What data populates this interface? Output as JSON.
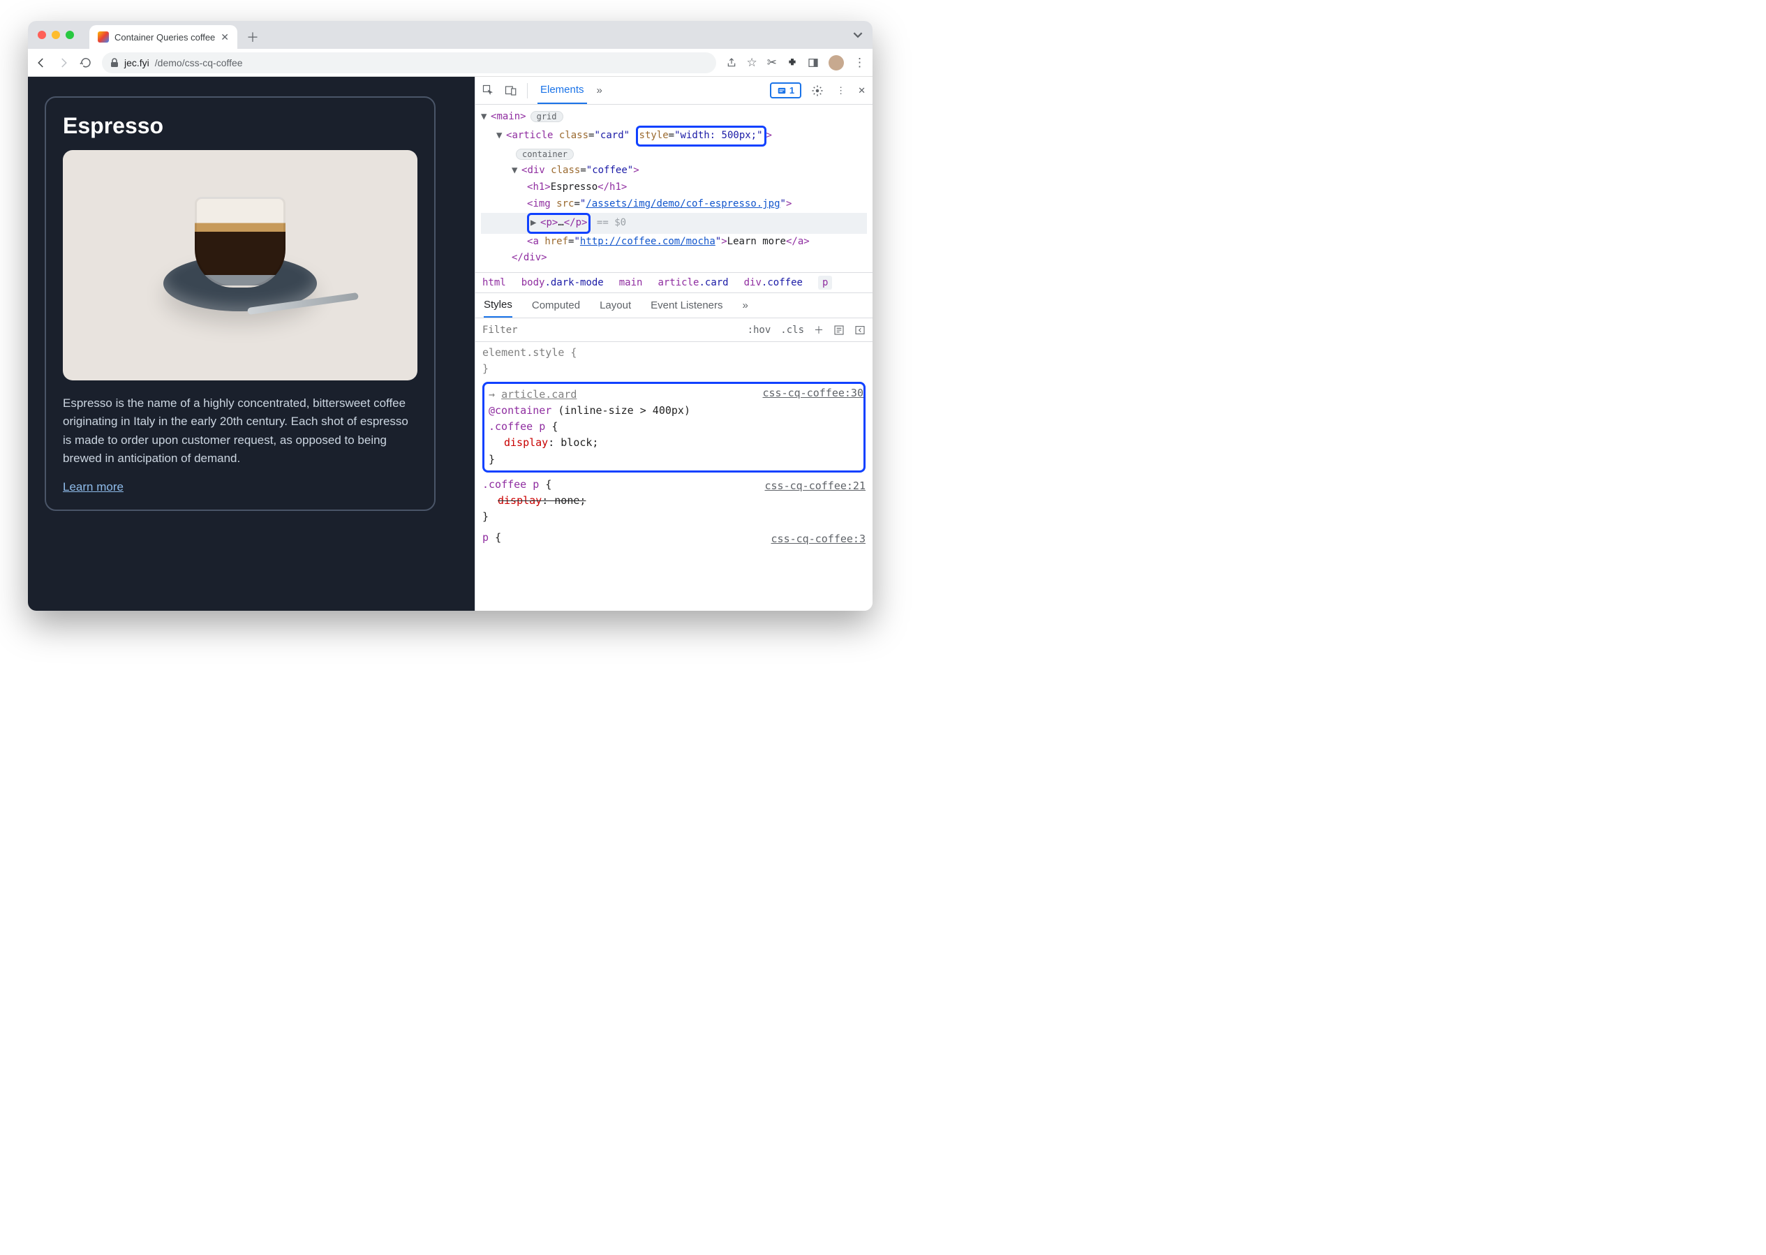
{
  "browser": {
    "tab_title": "Container Queries coffee",
    "url_host": "jec.fyi",
    "url_path": "/demo/css-cq-coffee"
  },
  "page": {
    "card_title": "Espresso",
    "card_desc": "Espresso is the name of a highly concentrated, bittersweet coffee originating in Italy in the early 20th century. Each shot of espresso is made to order upon customer request, as opposed to being brewed in anticipation of demand.",
    "card_link": "Learn more"
  },
  "devtools": {
    "tabs": {
      "elements": "Elements"
    },
    "issues_count": "1",
    "dom": {
      "main": "main",
      "grid": "grid",
      "article": "article",
      "class": "class",
      "card": "card",
      "style_attr": "style=\"width: 500px;\"",
      "container": "container",
      "div": "div",
      "coffee": "coffee",
      "h1": "h1",
      "h1_text": "Espresso",
      "img": "img",
      "src": "src",
      "img_src": "/assets/img/demo/cof-espresso.jpg",
      "p": "p",
      "ellipsis": "…",
      "eq0": "== $0",
      "a": "a",
      "href": "href",
      "a_href": "http://coffee.com/mocha",
      "a_text": "Learn more"
    },
    "crumbs": {
      "html": "html",
      "body": "body",
      "dark": ".dark-mode",
      "main": "main",
      "article": "article",
      "card": ".card",
      "div": "div",
      "coffee": ".coffee",
      "p": "p"
    },
    "subtabs": {
      "styles": "Styles",
      "computed": "Computed",
      "layout": "Layout",
      "listeners": "Event Listeners"
    },
    "filter": {
      "placeholder": "Filter",
      "hov": ":hov",
      "cls": ".cls"
    },
    "styles_pane": {
      "elstyle": "element.style {",
      "close": "}",
      "r1_src": "css-cq-coffee:30",
      "r1_arrow": "→",
      "r1_origin": "article.card",
      "r1_at": "@container (inline-size > 400px)",
      "r1_sel": ".coffee p {",
      "r1_prop": "display",
      "r1_val": "block;",
      "r2_src": "css-cq-coffee:21",
      "r2_sel": ".coffee p {",
      "r2_prop": "display",
      "r2_val": "none;",
      "r3_src": "css-cq-coffee:3",
      "r3_sel": "p {"
    }
  }
}
